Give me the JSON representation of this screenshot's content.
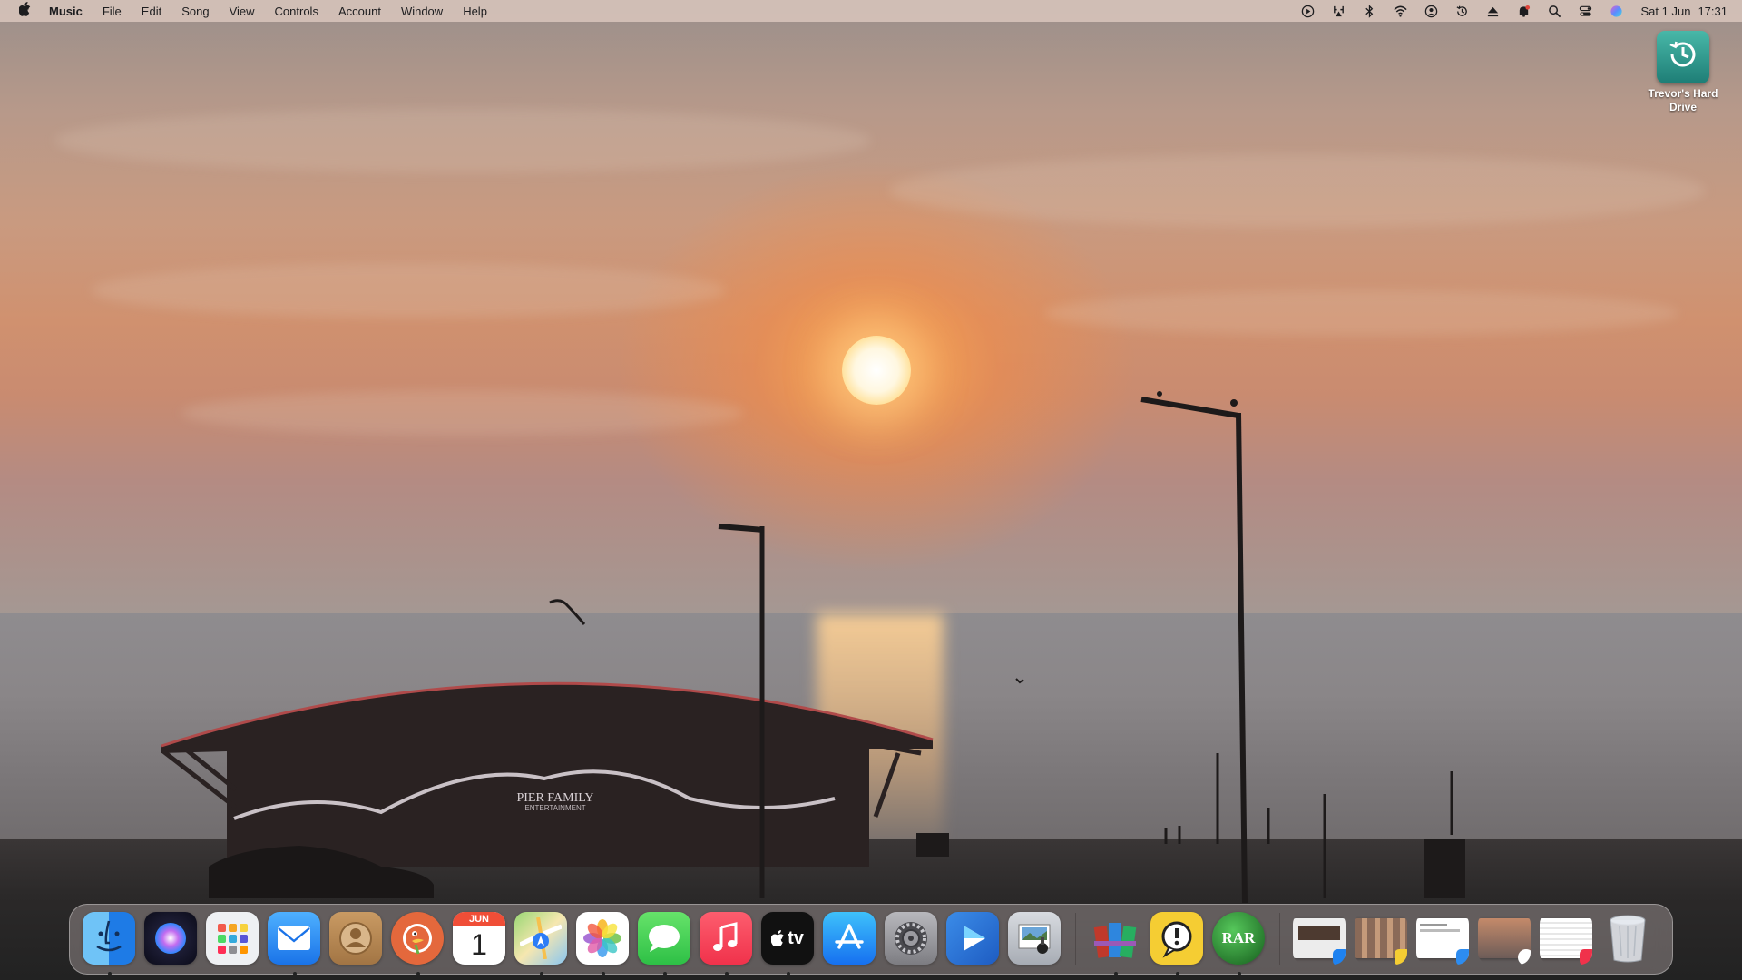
{
  "menubar": {
    "app_name": "Music",
    "menus": [
      "File",
      "Edit",
      "Song",
      "View",
      "Controls",
      "Account",
      "Window",
      "Help"
    ],
    "status_icons": [
      "play-circle-icon",
      "airplay-icon",
      "bluetooth-icon",
      "wifi-icon",
      "user-icon",
      "time-machine-icon",
      "eject-icon",
      "notification-icon",
      "search-icon",
      "control-center-icon",
      "siri-icon"
    ],
    "date": "Sat 1 Jun",
    "time": "17:31"
  },
  "desktop": {
    "drive_label": "Trevor's Hard Drive"
  },
  "wallpaper": {
    "building_sign": "PIER FAMILY",
    "building_sub": "ENTERTAINMENT"
  },
  "dock": {
    "apps": [
      "Finder",
      "Siri",
      "Launchpad",
      "Mail",
      "Contacts",
      "DuckDuckGo",
      "Calendar",
      "Maps",
      "Photos",
      "Messages",
      "Music",
      "TV",
      "App Store",
      "System Settings",
      "Infuse",
      "Preview"
    ],
    "extras": [
      "RAR Extractor",
      "Console",
      "RAR Expander"
    ],
    "calendar_month": "JUN",
    "calendar_day": "1",
    "tv_label": "tv",
    "rar_label": "RAR"
  },
  "colors": {
    "menubar_bg": "#dcc8be",
    "accent_teal": "#2a9488"
  }
}
